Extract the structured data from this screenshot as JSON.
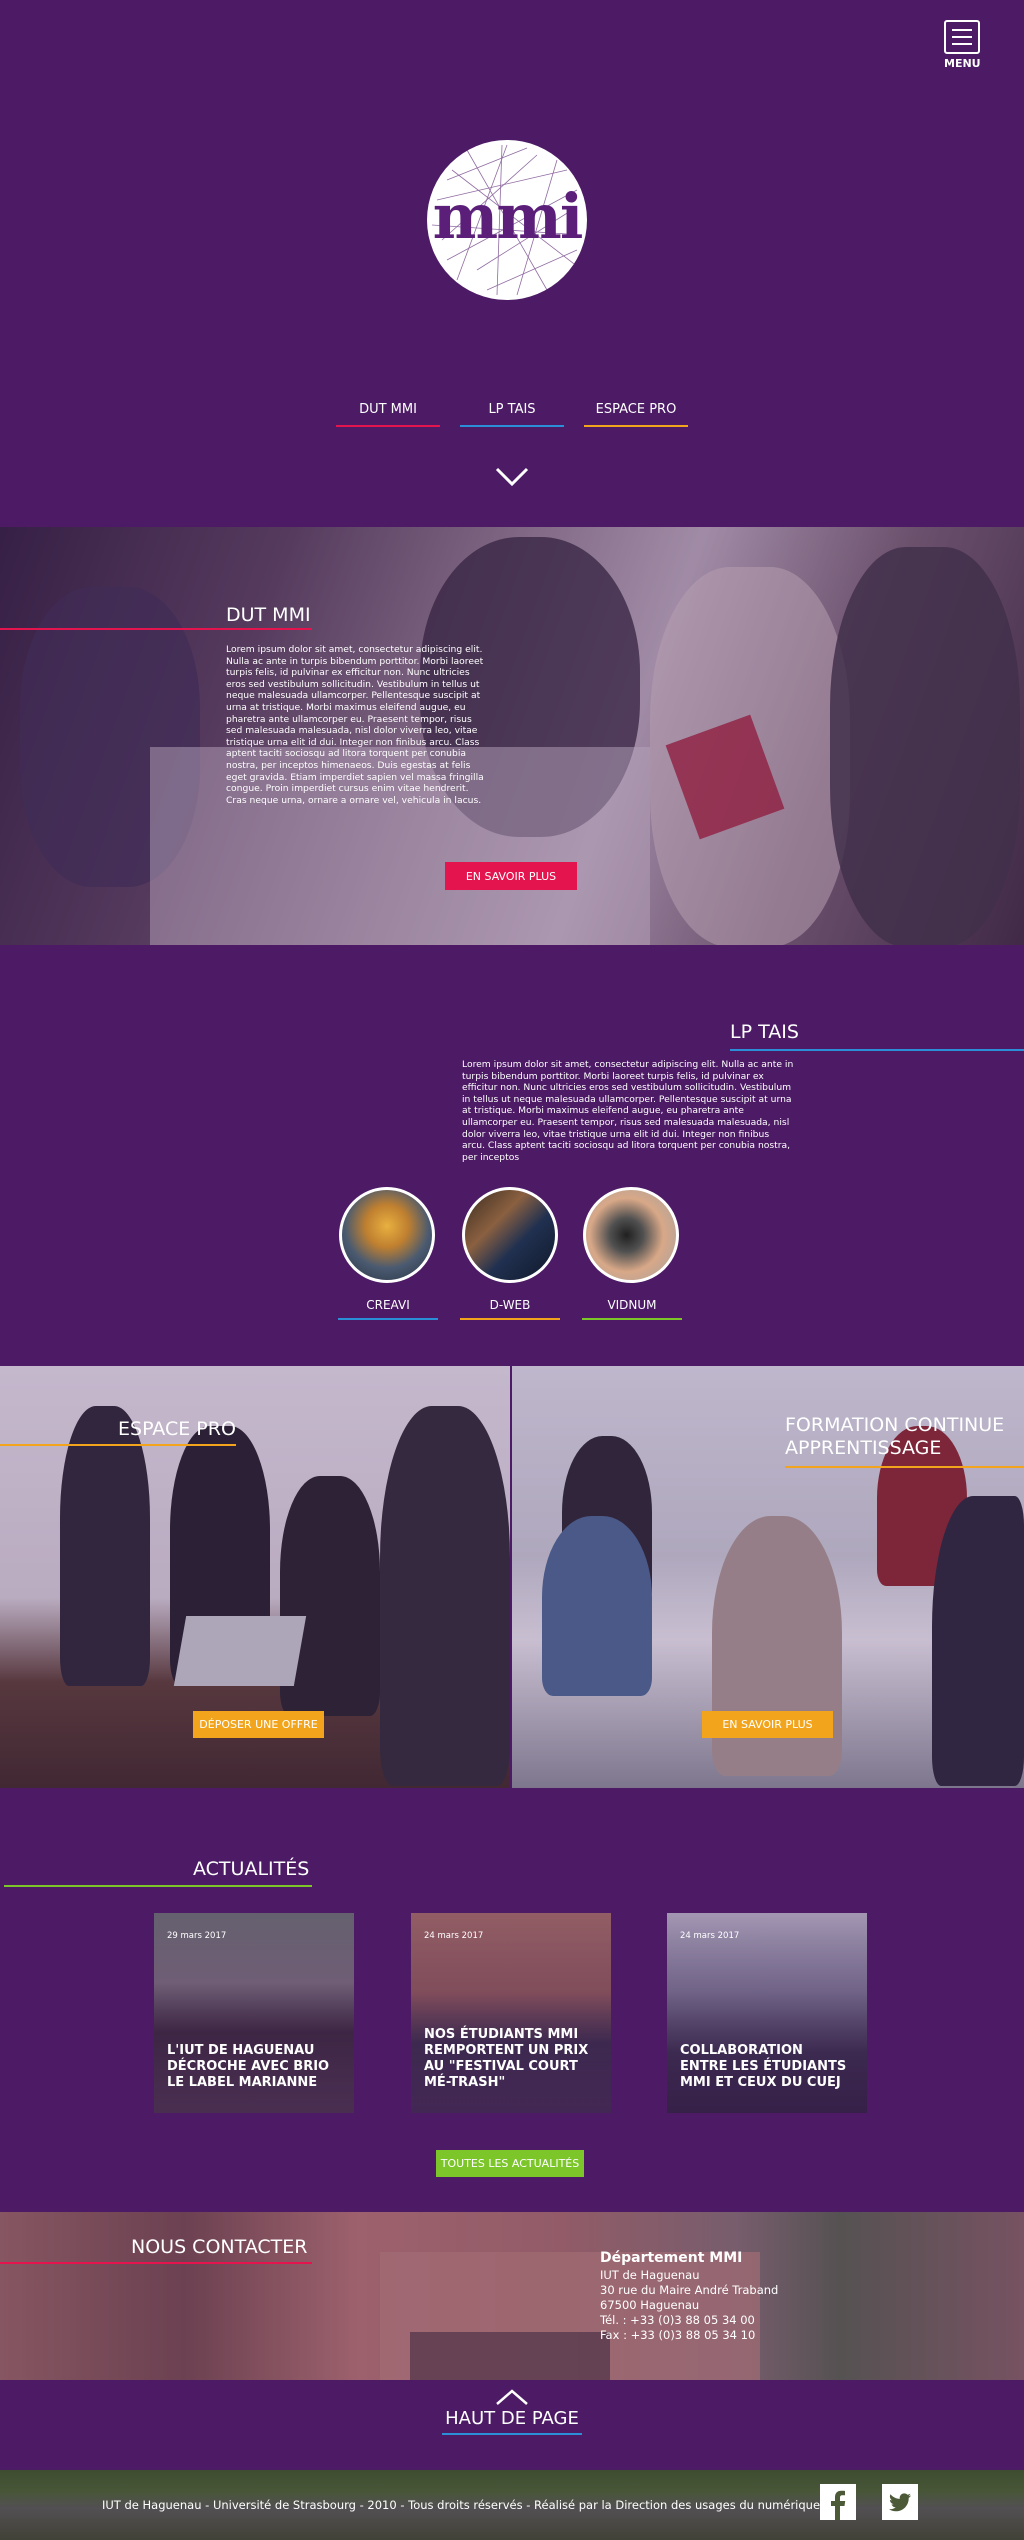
{
  "header": {
    "menu_label": "MENU",
    "logo_text": "mmi",
    "nav": [
      {
        "label": "DUT MMI",
        "color": "#e4154e"
      },
      {
        "label": "LP TAIS",
        "color": "#2a8fd6"
      },
      {
        "label": "ESPACE PRO",
        "color": "#f2a51c"
      }
    ]
  },
  "dut": {
    "title": "DUT MMI",
    "text": "Lorem ipsum dolor sit amet, consectetur adipiscing elit. Nulla ac ante in turpis bibendum porttitor. Morbi laoreet turpis felis, id pulvinar ex efficitur non. Nunc ultricies eros sed vestibulum sollicitudin. Vestibulum in tellus ut neque malesuada ullamcorper. Pellentesque suscipit at urna at tristique. Morbi maximus eleifend augue, eu pharetra ante ullamcorper eu. Praesent tempor, risus sed malesuada malesuada, nisl dolor viverra leo, vitae tristique urna elit id dui. Integer non finibus arcu. Class aptent taciti sociosqu ad litora torquent per conubia nostra, per inceptos himenaeos. Duis egestas at felis eget gravida. Etiam imperdiet sapien vel massa fringilla congue. Proin imperdiet cursus enim vitae hendrerit. Cras neque urna, ornare a ornare vel, vehicula in lacus.",
    "button": "EN SAVOIR PLUS",
    "accent": "#e4154e"
  },
  "lp": {
    "title": "LP TAIS",
    "text": "Lorem ipsum dolor sit amet, consectetur adipiscing elit. Nulla ac ante in turpis bibendum porttitor. Morbi laoreet turpis felis, id pulvinar ex efficitur non. Nunc ultricies eros sed vestibulum sollicitudin. Vestibulum in tellus ut neque malesuada ullamcorper. Pellentesque suscipit at urna at tristique. Morbi maximus eleifend augue, eu pharetra ante ullamcorper eu. Praesent tempor, risus sed malesuada malesuada, nisl dolor viverra leo, vitae tristique urna elit id dui. Integer non finibus arcu. Class aptent taciti sociosqu ad litora torquent per conubia nostra, per inceptos",
    "accent": "#2a8fd6",
    "options": [
      {
        "label": "CREAVI",
        "color": "#2a8fd6"
      },
      {
        "label": "D-WEB",
        "color": "#f2a51c"
      },
      {
        "label": "VIDNUM",
        "color": "#7cc62a"
      }
    ]
  },
  "pro": {
    "title": "ESPACE PRO",
    "button": "DÉPOSER UNE OFFRE",
    "accent": "#f2a51c"
  },
  "formation": {
    "title_line1": "FORMATION CONTINUE",
    "title_line2": "APPRENTISSAGE",
    "button": "EN SAVOIR PLUS",
    "accent": "#f2a51c"
  },
  "news": {
    "title": "ACTUALITÉS",
    "accent": "#7cc62a",
    "items": [
      {
        "date": "29 mars 2017",
        "title": "L'IUT DE HAGUENAU DÉCROCHE AVEC BRIO LE LABEL MARIANNE"
      },
      {
        "date": "24 mars 2017",
        "title": "NOS ÉTUDIANTS MMI REMPORTENT UN PRIX AU \"FESTIVAL COURT MÉ-TRASH\""
      },
      {
        "date": "24 mars 2017",
        "title": "COLLABORATION ENTRE LES ÉTUDIANTS MMI ET CEUX DU CUEJ"
      }
    ],
    "button": "TOUTES LES ACTUALITÉS"
  },
  "contact": {
    "title": "NOUS CONTACTER",
    "accent": "#e4154e",
    "dept": "Département MMI",
    "lines": [
      "IUT de Haguenau",
      "30 rue du Maire André Traband",
      "67500 Haguenau",
      "Tél. : +33 (0)3 88 05 34 00",
      "Fax : +33 (0)3 88 05 34 10"
    ]
  },
  "top": {
    "label": "HAUT DE PAGE"
  },
  "footer": {
    "text": "IUT de Haguenau - Université de Strasbourg - 2010 - Tous droits réservés - Réalisé par la Direction des usages du numérique",
    "social": [
      "facebook-icon",
      "twitter-icon"
    ]
  }
}
